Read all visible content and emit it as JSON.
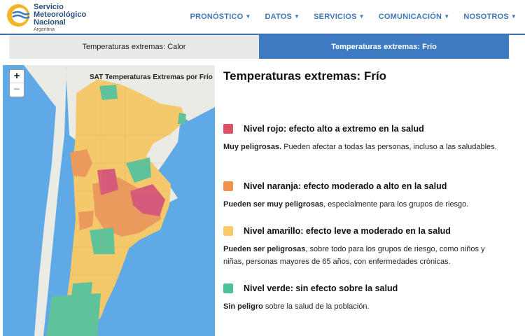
{
  "header": {
    "logo": {
      "line1": "Servicio",
      "line2": "Meteorológico",
      "line3": "Nacional",
      "sub": "Argentina"
    },
    "nav": [
      {
        "label": "PRONÓSTICO"
      },
      {
        "label": "DATOS"
      },
      {
        "label": "SERVICIOS"
      },
      {
        "label": "COMUNICACIÓN"
      },
      {
        "label": "NOSOTROS"
      }
    ]
  },
  "tabs": [
    {
      "label": "Temperaturas extremas: Calor",
      "active": false
    },
    {
      "label": "Temperaturas extremas: Frío",
      "active": true
    }
  ],
  "map": {
    "title": "SAT Temperaturas Extremas por Frío",
    "zoom_in": "+",
    "zoom_out": "−",
    "colors": {
      "sea": "#5fa9e6",
      "neighbor": "#ebebe6",
      "yellow": "#f4c96c",
      "orange": "#eb9a5d",
      "red": "#d65a7a",
      "green": "#5ec29b"
    }
  },
  "content": {
    "title": "Temperaturas extremas: Frío",
    "levels": [
      {
        "title": "Nivel rojo: efecto alto a extremo en la salud",
        "color": "#dc5068",
        "desc_bold": "Muy peligrosas.",
        "desc_rest": " Pueden afectar a todas las personas, incluso a las saludables."
      },
      {
        "title": "Nivel naranja: efecto moderado a alto en la salud",
        "color": "#f0924e",
        "desc_bold": "Pueden ser muy peligrosas",
        "desc_rest": ", especialmente para los grupos de riesgo."
      },
      {
        "title": "Nivel amarillo: efecto leve a moderado en la salud",
        "color": "#f7cb6a",
        "desc_bold": "Pueden ser peligrosas",
        "desc_rest": ", sobre todo para los grupos de riesgo, como niños y niñas, personas mayores de 65 años, con enfermedades crónicas."
      },
      {
        "title": "Nivel verde: sin efecto sobre la salud",
        "color": "#4cc195",
        "desc_bold": "Sin peligro",
        "desc_rest": " sobre la salud de la población."
      }
    ]
  }
}
